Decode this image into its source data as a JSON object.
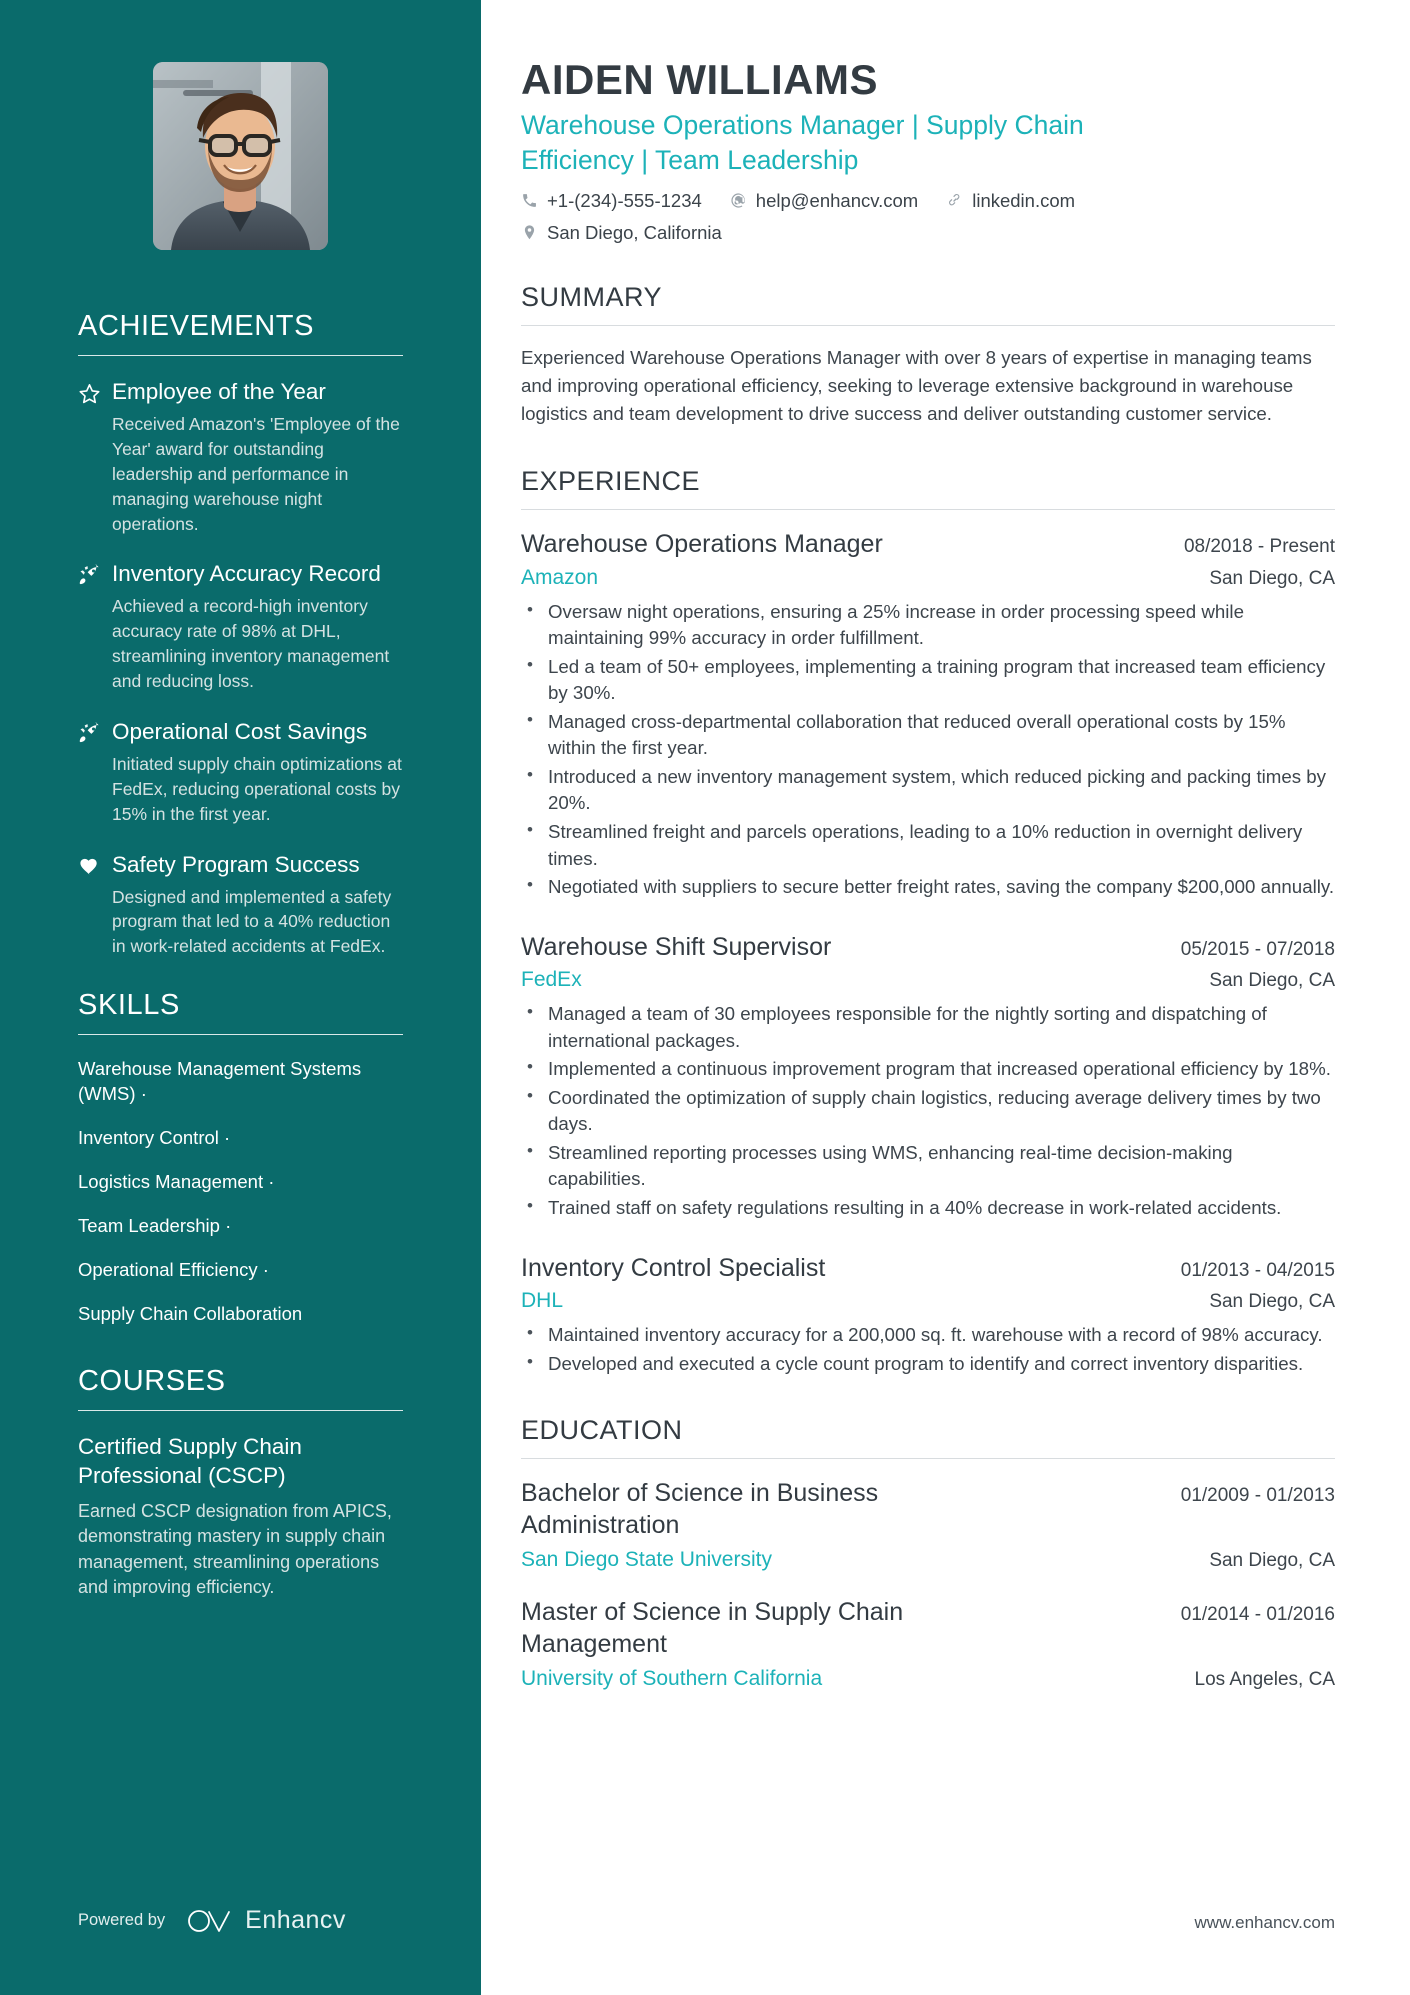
{
  "profile": {
    "name": "AIDEN WILLIAMS",
    "headline": "Warehouse Operations Manager | Supply Chain Efficiency | Team Leadership",
    "photo_alt": "portrait-photo",
    "contacts": [
      {
        "icon": "phone-icon",
        "text": "+1-(234)-555-1234"
      },
      {
        "icon": "email-icon",
        "text": "help@enhancv.com"
      },
      {
        "icon": "link-icon",
        "text": "linkedin.com"
      },
      {
        "icon": "location-icon",
        "text": "San Diego, California"
      }
    ]
  },
  "colors": {
    "sidebar_bg": "#0a6b6b",
    "accent": "#1cb2b8",
    "heading": "#333b42",
    "body_text": "#3d454c",
    "sidebar_muted": "#d4e2e2"
  },
  "sidebar": {
    "achievements": {
      "heading": "ACHIEVEMENTS",
      "items": [
        {
          "icon": "star-icon",
          "title": "Employee of the Year",
          "description": "Received Amazon's 'Employee of the Year' award for outstanding leadership and performance in managing warehouse night operations."
        },
        {
          "icon": "rocket-icon",
          "title": "Inventory Accuracy Record",
          "description": "Achieved a record-high inventory accuracy rate of 98% at DHL, streamlining inventory management and reducing loss."
        },
        {
          "icon": "rocket-icon",
          "title": "Operational Cost Savings",
          "description": "Initiated supply chain optimizations at FedEx, reducing operational costs by 15% in the first year."
        },
        {
          "icon": "heart-icon",
          "title": "Safety Program Success",
          "description": "Designed and implemented a safety program that led to a 40% reduction in work-related accidents at FedEx."
        }
      ]
    },
    "skills": {
      "heading": "SKILLS",
      "items": [
        {
          "label": "Warehouse Management Systems (WMS)",
          "separator": "·"
        },
        {
          "label": "Inventory Control",
          "separator": "·"
        },
        {
          "label": "Logistics Management",
          "separator": "·"
        },
        {
          "label": "Team Leadership",
          "separator": "·"
        },
        {
          "label": "Operational Efficiency",
          "separator": "·"
        },
        {
          "label": "Supply Chain Collaboration",
          "separator": ""
        }
      ]
    },
    "courses": {
      "heading": "COURSES",
      "items": [
        {
          "title": "Certified Supply Chain Professional (CSCP)",
          "description": "Earned CSCP designation from APICS, demonstrating mastery in supply chain management, streamlining operations and improving efficiency."
        }
      ]
    },
    "footer": {
      "powered_by": "Powered by",
      "brand": "Enhancv"
    }
  },
  "main": {
    "summary": {
      "heading": "SUMMARY",
      "text": "Experienced Warehouse Operations Manager with over 8 years of expertise in managing teams and improving operational efficiency, seeking to leverage extensive background in warehouse logistics and team development to drive success and deliver outstanding customer service."
    },
    "experience": {
      "heading": "EXPERIENCE",
      "jobs": [
        {
          "title": "Warehouse Operations Manager",
          "dates": "08/2018 - Present",
          "company": "Amazon",
          "location": "San Diego, CA",
          "bullets": [
            "Oversaw night operations, ensuring a 25% increase in order processing speed while maintaining 99% accuracy in order fulfillment.",
            "Led a team of 50+ employees, implementing a training program that increased team efficiency by 30%.",
            "Managed cross-departmental collaboration that reduced overall operational costs by 15% within the first year.",
            "Introduced a new inventory management system, which reduced picking and packing times by 20%.",
            "Streamlined freight and parcels operations, leading to a 10% reduction in overnight delivery times.",
            "Negotiated with suppliers to secure better freight rates, saving the company $200,000 annually."
          ]
        },
        {
          "title": "Warehouse Shift Supervisor",
          "dates": "05/2015 - 07/2018",
          "company": "FedEx",
          "location": "San Diego, CA",
          "bullets": [
            "Managed a team of 30 employees responsible for the nightly sorting and dispatching of international packages.",
            "Implemented a continuous improvement program that increased operational efficiency by 18%.",
            "Coordinated the optimization of supply chain logistics, reducing average delivery times by two days.",
            "Streamlined reporting processes using WMS, enhancing real-time decision-making capabilities.",
            "Trained staff on safety regulations resulting in a 40% decrease in work-related accidents."
          ]
        },
        {
          "title": "Inventory Control Specialist",
          "dates": "01/2013 - 04/2015",
          "company": "DHL",
          "location": "San Diego, CA",
          "bullets": [
            "Maintained inventory accuracy for a 200,000 sq. ft. warehouse with a record of 98% accuracy.",
            "Developed and executed a cycle count program to identify and correct inventory disparities."
          ]
        }
      ]
    },
    "education": {
      "heading": "EDUCATION",
      "entries": [
        {
          "degree": "Bachelor of Science in Business Administration",
          "dates": "01/2009 - 01/2013",
          "school": "San Diego State University",
          "location": "San Diego, CA"
        },
        {
          "degree": "Master of Science in Supply Chain Management",
          "dates": "01/2014 - 01/2016",
          "school": "University of Southern California",
          "location": "Los Angeles, CA"
        }
      ]
    },
    "footer": {
      "website": "www.enhancv.com"
    }
  }
}
